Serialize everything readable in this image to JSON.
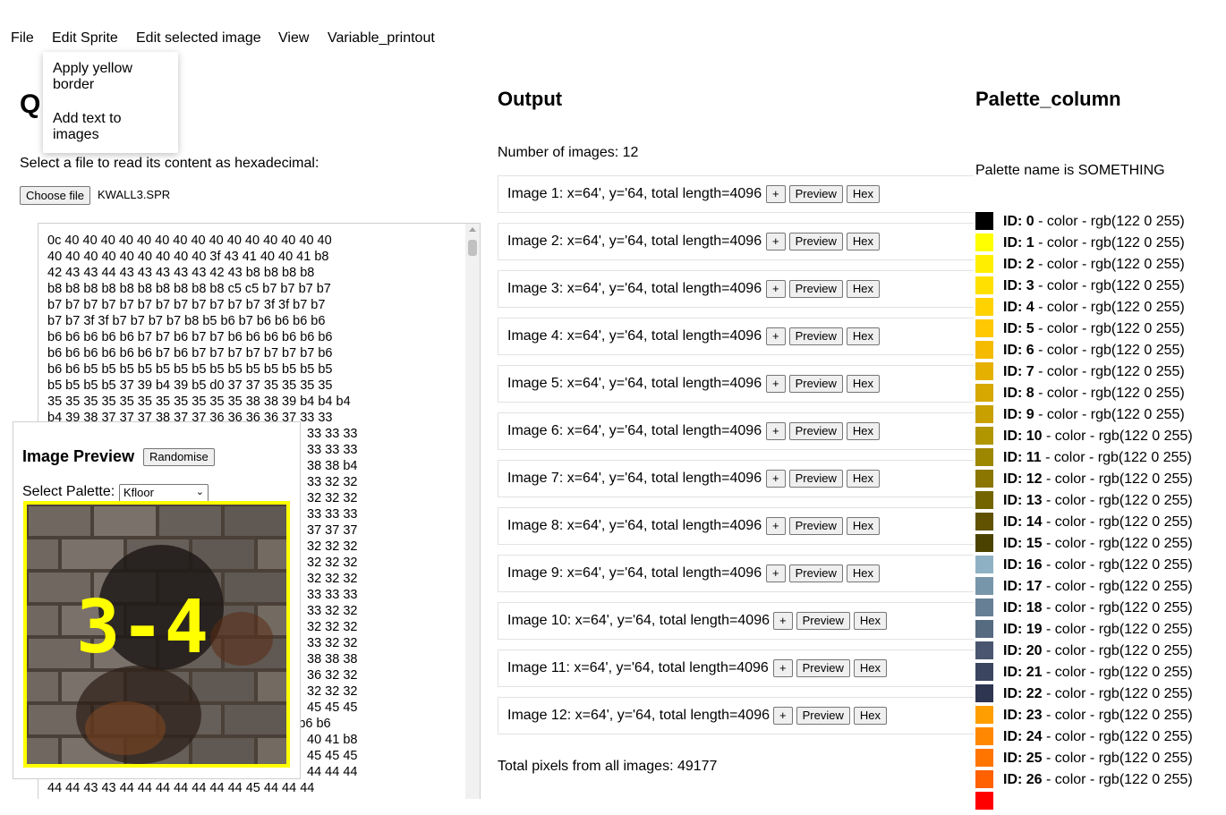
{
  "menu": {
    "items": [
      "File",
      "Edit Sprite",
      "Edit selected image",
      "View",
      "Variable_printout"
    ],
    "dropdown": [
      "Apply yellow border",
      "Add text to images"
    ]
  },
  "left": {
    "heading": "Q",
    "file_prompt": "Select a file to read its content as hexadecimal:",
    "choose_file_label": "Choose file",
    "file_name": "KWALL3.SPR",
    "hex_lines": [
      "0c 40 40 40 40 40 40 40 40 40 40 40 40 40 40 40",
      "40 40 40 40 40 40 40 40 40 3f 43 41 40 40 41 b8",
      "42 43 43 44 43 43 43 43 43 42 43 b8 b8 b8 b8",
      "b8 b8 b8 b8 b8 b8 b8 b8 b8 b8 c5 c5 b7 b7 b7 b7",
      "b7 b7 b7 b7 b7 b7 b7 b7 b7 b7 b7 b7 3f 3f b7 b7",
      "b7 b7 3f 3f b7 b7 b7 b7 b8 b5 b6 b7 b6 b6 b6 b6",
      "b6 b6 b6 b6 b6 b7 b7 b6 b7 b7 b6 b6 b6 b6 b6 b6",
      "b6 b6 b6 b6 b6 b6 b7 b6 b7 b7 b7 b7 b7 b7 b7 b6",
      "b6 b6 b5 b5 b5 b5 b5 b5 b5 b5 b5 b5 b5 b5 b5 b5",
      "b5 b5 b5 b5 37 39 b4 39 b5 d0 37 37 35 35 35 35",
      "35 35 35 35 35 35 35 35 35 35 35 38 38 39 b4 b4 b4",
      "b4 39 38 37 37 37 38 37 37 36 36 36 36 37 33 33"
    ],
    "hex_tails": [
      "33 33 33",
      "33 33 33",
      "38 38 b4",
      "33 32 32",
      "32 32 32",
      "33 33 33",
      "37 37 37",
      "32 32 32",
      "32 32 32",
      "32 32 32",
      "33 33 33",
      "33 32 32",
      "32 32 32",
      "33 32 32",
      "38 38 38",
      "36 32 32",
      "32 32 32",
      "45 45 45",
      "b6 b6 b6",
      "40 41 b8",
      "45 45 45",
      "44 44 44"
    ],
    "hex_tail_prefix": {
      "index": 18,
      "text": "b6 "
    },
    "hex_last_line": "44 44 43 43 44 44 44 44 44 44 44 45 44 44 44"
  },
  "preview": {
    "title": "Image Preview",
    "randomise_label": "Randomise",
    "palette_label": "Select Palette:",
    "palette_selected": "Kfloor",
    "overlay_text": "3-4",
    "border_color": "#ffff00"
  },
  "output": {
    "title": "Output",
    "num_images": "Number of images: 12",
    "images": [
      {
        "label": "Image 1: x=64', y='64, total length=4096"
      },
      {
        "label": "Image 2: x=64', y='64, total length=4096"
      },
      {
        "label": "Image 3: x=64', y='64, total length=4096"
      },
      {
        "label": "Image 4: x=64', y='64, total length=4096"
      },
      {
        "label": "Image 5: x=64', y='64, total length=4096"
      },
      {
        "label": "Image 6: x=64', y='64, total length=4096"
      },
      {
        "label": "Image 7: x=64', y='64, total length=4096"
      },
      {
        "label": "Image 8: x=64', y='64, total length=4096"
      },
      {
        "label": "Image 9: x=64', y='64, total length=4096"
      },
      {
        "label": "Image 10: x=64', y='64, total length=4096"
      },
      {
        "label": "Image 11: x=64', y='64, total length=4096"
      },
      {
        "label": "Image 12: x=64', y='64, total length=4096"
      }
    ],
    "buttons": {
      "plus": "+",
      "preview": "Preview",
      "hex": "Hex"
    },
    "total_pixels": "Total pixels from all images: 49177"
  },
  "palette": {
    "title": "Palette_column",
    "name_text": "Palette name is SOMETHING",
    "entries": [
      {
        "id": "ID: 0",
        "desc": " - color - rgb(122 0 255)",
        "swatch": "#000000"
      },
      {
        "id": "ID: 1",
        "desc": " - color - rgb(122 0 255)",
        "swatch": "#ffff00"
      },
      {
        "id": "ID: 2",
        "desc": " - color - rgb(122 0 255)",
        "swatch": "#ffee00"
      },
      {
        "id": "ID: 3",
        "desc": " - color - rgb(122 0 255)",
        "swatch": "#ffe000"
      },
      {
        "id": "ID: 4",
        "desc": " - color - rgb(122 0 255)",
        "swatch": "#ffd200"
      },
      {
        "id": "ID: 5",
        "desc": " - color - rgb(122 0 255)",
        "swatch": "#ffc800"
      },
      {
        "id": "ID: 6",
        "desc": " - color - rgb(122 0 255)",
        "swatch": "#f5bb00"
      },
      {
        "id": "ID: 7",
        "desc": " - color - rgb(122 0 255)",
        "swatch": "#e6b000"
      },
      {
        "id": "ID: 8",
        "desc": " - color - rgb(122 0 255)",
        "swatch": "#d6a800"
      },
      {
        "id": "ID: 9",
        "desc": " - color - rgb(122 0 255)",
        "swatch": "#c8a000"
      },
      {
        "id": "ID: 10",
        "desc": " - color - rgb(122 0 255)",
        "swatch": "#b29600"
      },
      {
        "id": "ID: 11",
        "desc": " - color - rgb(122 0 255)",
        "swatch": "#9e8700"
      },
      {
        "id": "ID: 12",
        "desc": " - color - rgb(122 0 255)",
        "swatch": "#8a7600"
      },
      {
        "id": "ID: 13",
        "desc": " - color - rgb(122 0 255)",
        "swatch": "#746400"
      },
      {
        "id": "ID: 14",
        "desc": " - color - rgb(122 0 255)",
        "swatch": "#605200"
      },
      {
        "id": "ID: 15",
        "desc": " - color - rgb(122 0 255)",
        "swatch": "#4c4200"
      },
      {
        "id": "ID: 16",
        "desc": " - color - rgb(122 0 255)",
        "swatch": "#8fb1c4"
      },
      {
        "id": "ID: 17",
        "desc": " - color - rgb(122 0 255)",
        "swatch": "#7896aa"
      },
      {
        "id": "ID: 18",
        "desc": " - color - rgb(122 0 255)",
        "swatch": "#667f94"
      },
      {
        "id": "ID: 19",
        "desc": " - color - rgb(122 0 255)",
        "swatch": "#566a80"
      },
      {
        "id": "ID: 20",
        "desc": " - color - rgb(122 0 255)",
        "swatch": "#4a566f"
      },
      {
        "id": "ID: 21",
        "desc": " - color - rgb(122 0 255)",
        "swatch": "#3b4560"
      },
      {
        "id": "ID: 22",
        "desc": " - color - rgb(122 0 255)",
        "swatch": "#2e3550"
      },
      {
        "id": "ID: 23",
        "desc": " - color - rgb(122 0 255)",
        "swatch": "#ff9e00"
      },
      {
        "id": "ID: 24",
        "desc": " - color - rgb(122 0 255)",
        "swatch": "#ff8800"
      },
      {
        "id": "ID: 25",
        "desc": " - color - rgb(122 0 255)",
        "swatch": "#ff7500"
      },
      {
        "id": "ID: 26",
        "desc": " - color - rgb(122 0 255)",
        "swatch": "#ff6000"
      },
      {
        "id": "",
        "desc": "",
        "swatch": "#ff0000"
      }
    ]
  }
}
